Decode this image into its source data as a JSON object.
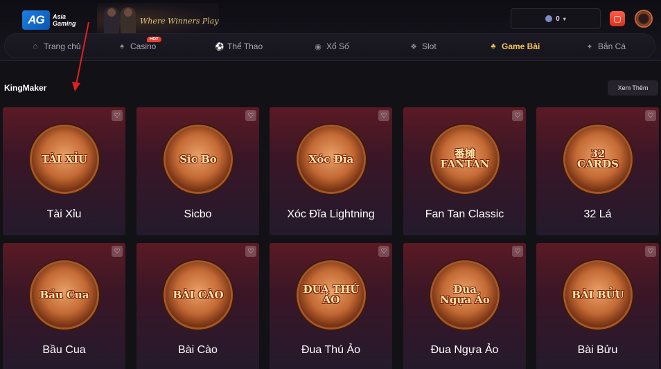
{
  "header": {
    "logo_mark": "AG",
    "logo_text_1": "Asia",
    "logo_text_2": "Gaming",
    "promo_text": "Where Winners Play",
    "balance": "0",
    "avatar_icon": "avatar-icon",
    "action_icon": "gift-icon"
  },
  "nav": {
    "items": [
      {
        "label": "Trang chủ",
        "icon": "home-icon"
      },
      {
        "label": "Casino",
        "icon": "spade-icon",
        "badge": "HOT"
      },
      {
        "label": "Thể Thao",
        "icon": "soccer-ball-icon"
      },
      {
        "label": "Xổ Số",
        "icon": "lottery-icon"
      },
      {
        "label": "Slot",
        "icon": "slot-icon"
      },
      {
        "label": "Game Bài",
        "icon": "cards-icon",
        "active": true
      },
      {
        "label": "Bắn Cá",
        "icon": "fish-icon"
      }
    ]
  },
  "section": {
    "title": "KingMaker",
    "more": "Xem Thêm"
  },
  "games": [
    {
      "name": "Tài Xỉu",
      "art": "TÀI XỈU"
    },
    {
      "name": "Sicbo",
      "art": "Sic Bo"
    },
    {
      "name": "Xóc Đĩa Lightning",
      "art": "Xóc Đĩa"
    },
    {
      "name": "Fan Tan Classic",
      "art": "番摊 FANTAN"
    },
    {
      "name": "32 Lá",
      "art": "32 CARDS"
    },
    {
      "name": "Bầu Cua",
      "art": "Bầu Cua"
    },
    {
      "name": "Bài Cào",
      "art": "BÀI CÀO"
    },
    {
      "name": "Đua Thú Ảo",
      "art": "ĐUA THÚ ẢO"
    },
    {
      "name": "Đua Ngựa Ảo",
      "art": "Đua Ngựa Ảo"
    },
    {
      "name": "Bài Bửu",
      "art": "BÀI BỬU"
    }
  ],
  "colors": {
    "accent": "#f2c35b",
    "hot_badge": "#e8402f",
    "annotation_arrow": "#e02020"
  }
}
